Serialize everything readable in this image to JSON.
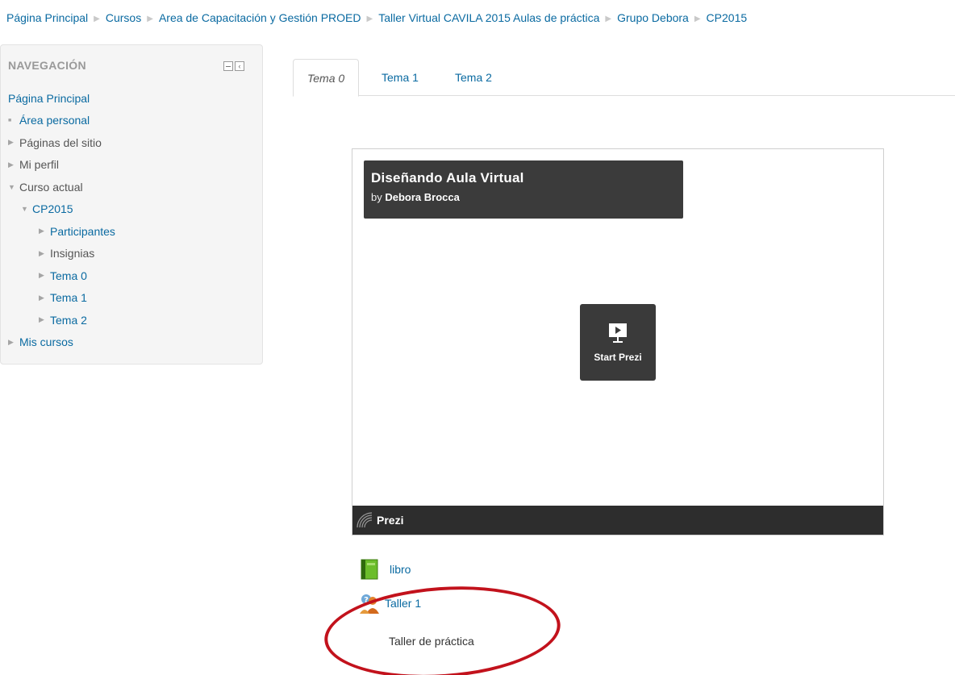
{
  "breadcrumb": [
    "Página Principal",
    "Cursos",
    "Area de Capacitación y Gestión PROED",
    "Taller Virtual CAVILA 2015 Aulas de práctica",
    "Grupo Debora",
    "CP2015"
  ],
  "navigation": {
    "title": "NAVEGACIÓN",
    "home": "Página Principal",
    "items": [
      {
        "label": "Área personal"
      },
      {
        "label": "Páginas del sitio"
      },
      {
        "label": "Mi perfil"
      },
      {
        "label": "Curso actual"
      },
      {
        "label": "CP2015"
      },
      {
        "label": "Participantes"
      },
      {
        "label": "Insignias"
      },
      {
        "label": "Tema 0"
      },
      {
        "label": "Tema 1"
      },
      {
        "label": "Tema 2"
      },
      {
        "label": "Mis cursos"
      }
    ]
  },
  "tabs": [
    {
      "label": "Tema 0",
      "active": true
    },
    {
      "label": "Tema 1",
      "active": false
    },
    {
      "label": "Tema 2",
      "active": false
    }
  ],
  "prezi": {
    "title": "Diseñando Aula Virtual",
    "by_prefix": "by",
    "author": "Debora Brocca",
    "start_label": "Start Prezi",
    "brand": "Prezi"
  },
  "activities": [
    {
      "label": "libro",
      "icon": "book-icon"
    },
    {
      "label": "Taller 1",
      "icon": "workshop-icon"
    }
  ],
  "activity_description": "Taller de práctica",
  "colors": {
    "link": "#0a6aa1",
    "annotation": "#c2121c"
  }
}
